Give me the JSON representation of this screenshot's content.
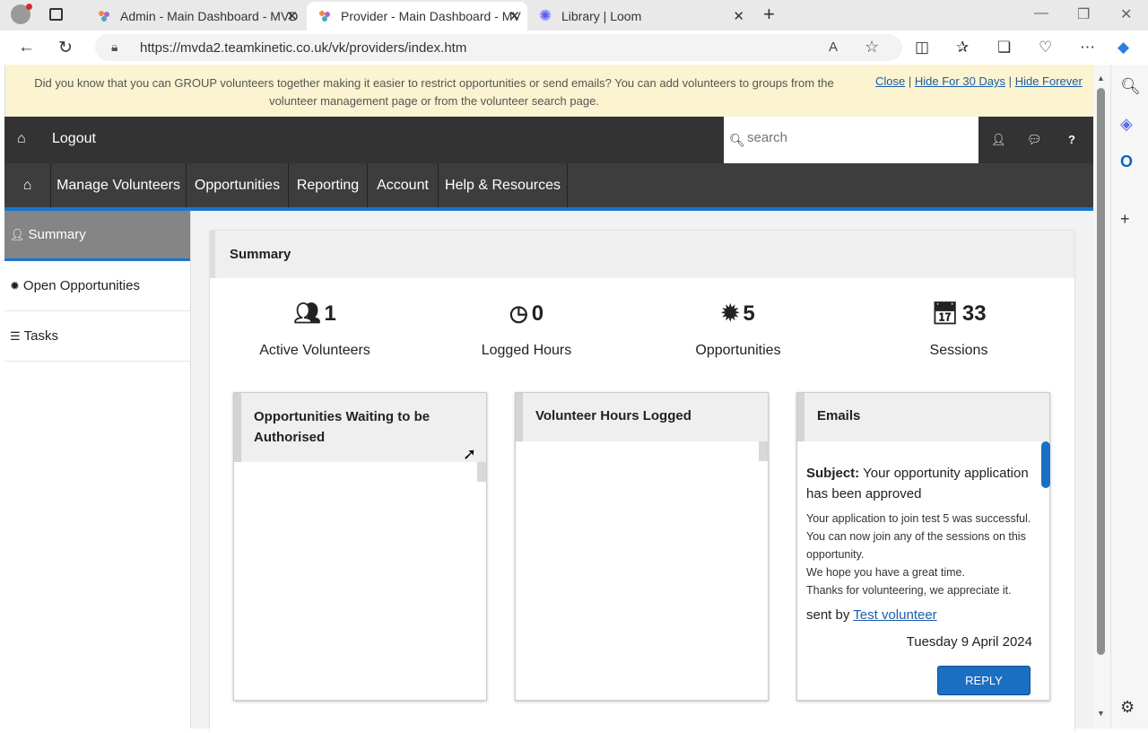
{
  "browser": {
    "tabs": [
      {
        "title": "Admin - Main Dashboard - MVD",
        "icon": "teamkinetic-icon",
        "active": false
      },
      {
        "title": "Provider - Main Dashboard - MV",
        "icon": "teamkinetic-icon",
        "active": true
      },
      {
        "title": "Library | Loom",
        "icon": "loom-icon",
        "active": false
      }
    ],
    "url": "https://mvda2.teamkinetic.co.uk/vk/providers/index.htm"
  },
  "notice": {
    "text": "Did you know that you can GROUP volunteers together making it easier to restrict opportunities or send emails? You can add volunteers to groups from the volunteer management page or from the volunteer search page.",
    "close": "Close",
    "hide30": "Hide For 30 Days",
    "hideForever": "Hide Forever",
    "sep": "|"
  },
  "topbar": {
    "logout": "Logout",
    "search_placeholder": "search"
  },
  "nav": {
    "items": [
      "Manage Volunteers",
      "Opportunities",
      "Reporting",
      "Account",
      "Help & Resources"
    ]
  },
  "sidebar": {
    "items": [
      "Summary",
      "Open Opportunities",
      "Tasks"
    ]
  },
  "summary": {
    "title": "Summary",
    "stats": [
      {
        "value": "1",
        "label": "Active Volunteers",
        "icon": "users-icon"
      },
      {
        "value": "0",
        "label": "Logged Hours",
        "icon": "clock-icon"
      },
      {
        "value": "5",
        "label": "Opportunities",
        "icon": "badge-icon"
      },
      {
        "value": "33",
        "label": "Sessions",
        "icon": "calendar-icon"
      }
    ]
  },
  "cards": {
    "waiting": {
      "title": "Opportunities Waiting to be Authorised"
    },
    "hours": {
      "title": "Volunteer Hours Logged"
    },
    "emails": {
      "title": "Emails",
      "subject_label": "Subject:",
      "subject": "Your opportunity application has been approved",
      "lines": [
        "Your application to join test 5 was successful.",
        "You can now join any of the sessions on this opportunity.",
        "We hope you have a great time.",
        "Thanks for volunteering, we appreciate it."
      ],
      "sent_by_label": "sent by",
      "sender": "Test volunteer",
      "date": "Tuesday 9 April 2024",
      "reply": "REPLY"
    }
  }
}
